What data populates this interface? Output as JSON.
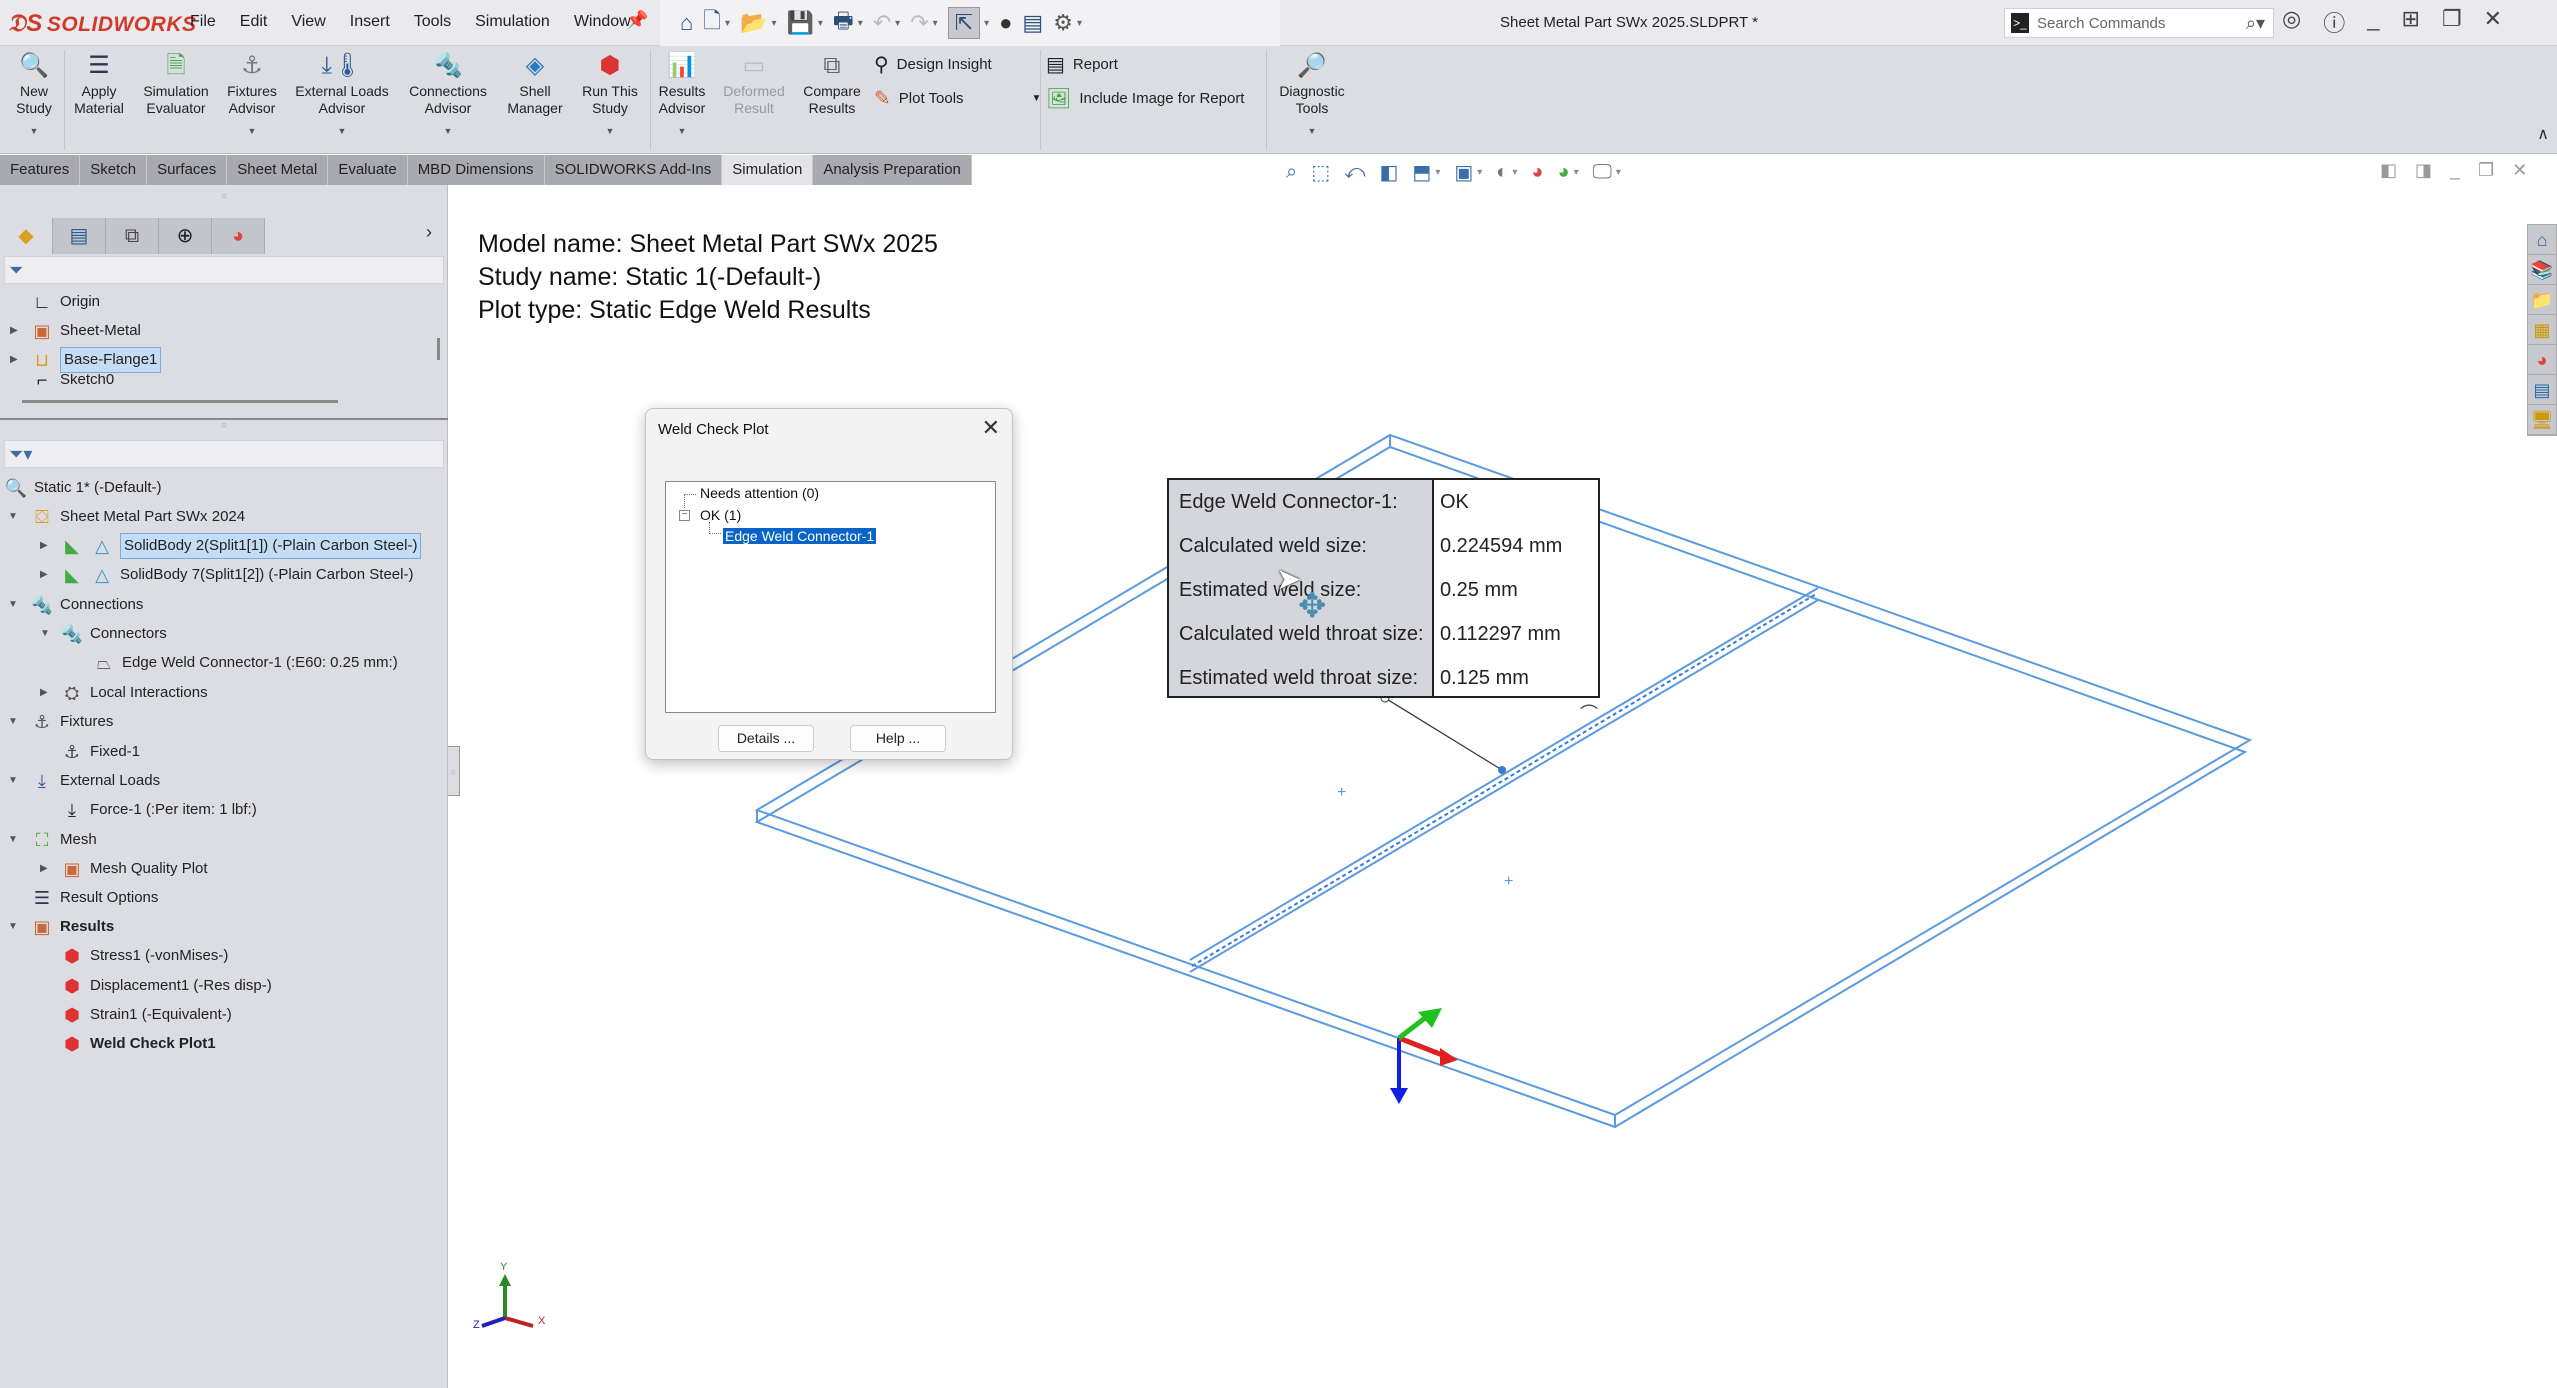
{
  "app": {
    "logo": "SOLIDWORKS",
    "menu": [
      "File",
      "Edit",
      "View",
      "Insert",
      "Tools",
      "Simulation",
      "Window"
    ],
    "document_title": "Sheet Metal Part SWx 2025.SLDPRT *",
    "search_placeholder": "Search Commands"
  },
  "ribbon": {
    "buttons": [
      {
        "label": "New Study",
        "icon": "new-study-icon"
      },
      {
        "label": "Apply Material",
        "icon": "apply-material-icon"
      },
      {
        "label": "Simulation Evaluator",
        "icon": "simulation-evaluator-icon"
      },
      {
        "label": "Fixtures Advisor",
        "icon": "fixtures-advisor-icon"
      },
      {
        "label": "External Loads Advisor",
        "icon": "external-loads-icon"
      },
      {
        "label": "Connections Advisor",
        "icon": "connections-advisor-icon"
      },
      {
        "label": "Shell Manager",
        "icon": "shell-manager-icon"
      },
      {
        "label": "Run This Study",
        "icon": "run-study-icon"
      },
      {
        "label": "Results Advisor",
        "icon": "results-advisor-icon"
      },
      {
        "label": "Deformed Result",
        "icon": "deformed-result-icon",
        "disabled": true
      },
      {
        "label": "Compare Results",
        "icon": "compare-results-icon"
      },
      {
        "label": "Diagnostic Tools",
        "icon": "diagnostic-tools-icon"
      }
    ],
    "small_buttons": {
      "design_insight": "Design Insight",
      "plot_tools": "Plot Tools",
      "report": "Report",
      "include_image": "Include Image for Report"
    }
  },
  "tabs": [
    {
      "label": "Features",
      "active": false
    },
    {
      "label": "Sketch",
      "active": false
    },
    {
      "label": "Surfaces",
      "active": false
    },
    {
      "label": "Sheet Metal",
      "active": false
    },
    {
      "label": "Evaluate",
      "active": false
    },
    {
      "label": "MBD Dimensions",
      "active": false
    },
    {
      "label": "SOLIDWORKS Add-Ins",
      "active": false
    },
    {
      "label": "Simulation",
      "active": true
    },
    {
      "label": "Analysis Preparation",
      "active": false
    }
  ],
  "feature_tree": [
    {
      "label": "Origin",
      "icon": "origin-icon"
    },
    {
      "label": "Sheet-Metal",
      "icon": "sheet-metal-folder-icon",
      "expandable": true
    },
    {
      "label": "Base-Flange1",
      "icon": "base-flange-icon",
      "expandable": true,
      "selected": true
    },
    {
      "label": "Sketch0",
      "icon": "sketch-icon"
    }
  ],
  "study_tree": {
    "study": "Static 1* (-Default-)",
    "part": "Sheet Metal Part SWx 2024",
    "bodies": [
      "SolidBody 2(Split1[1]) (-Plain Carbon Steel-)",
      "SolidBody 7(Split1[2]) (-Plain Carbon Steel-)"
    ],
    "connections": "Connections",
    "connectors": "Connectors",
    "edge_weld": "Edge Weld Connector-1 (:E60: 0.25 mm:)",
    "local_interactions": "Local Interactions",
    "fixtures": "Fixtures",
    "fixed": "Fixed-1",
    "external_loads": "External Loads",
    "force": "Force-1 (:Per item: 1 lbf:)",
    "mesh": "Mesh",
    "mesh_quality": "Mesh Quality Plot",
    "result_options": "Result Options",
    "results": "Results",
    "result_items": [
      "Stress1 (-vonMises-)",
      "Displacement1 (-Res disp-)",
      "Strain1 (-Equivalent-)",
      "Weld Check Plot1"
    ]
  },
  "viewport": {
    "model_name": "Model name: Sheet Metal Part SWx 2025",
    "study_name": "Study name: Static 1(-Default-)",
    "plot_type": "Plot type: Static Edge Weld Results",
    "triad_labels": {
      "x": "X",
      "y": "Y",
      "z": "Z"
    }
  },
  "weld_info": {
    "rows": [
      {
        "label": "Edge Weld Connector-1:",
        "value": "OK"
      },
      {
        "label": "Calculated weld size:",
        "value": "0.224594 mm"
      },
      {
        "label": "Estimated weld size:",
        "value": "0.25 mm"
      },
      {
        "label": "Calculated weld throat size:",
        "value": "0.112297 mm"
      },
      {
        "label": "Estimated weld throat size:",
        "value": "0.125 mm"
      }
    ]
  },
  "dialog": {
    "title": "Weld Check Plot",
    "tree": {
      "needs_attention": "Needs attention (0)",
      "ok": "OK (1)",
      "ok_child": "Edge Weld Connector-1"
    },
    "details_button": "Details ...",
    "help_button": "Help ..."
  },
  "colors": {
    "accent": "#d03a2a",
    "model_edges": "#5a9ae0",
    "selection": "#0a64c8"
  }
}
